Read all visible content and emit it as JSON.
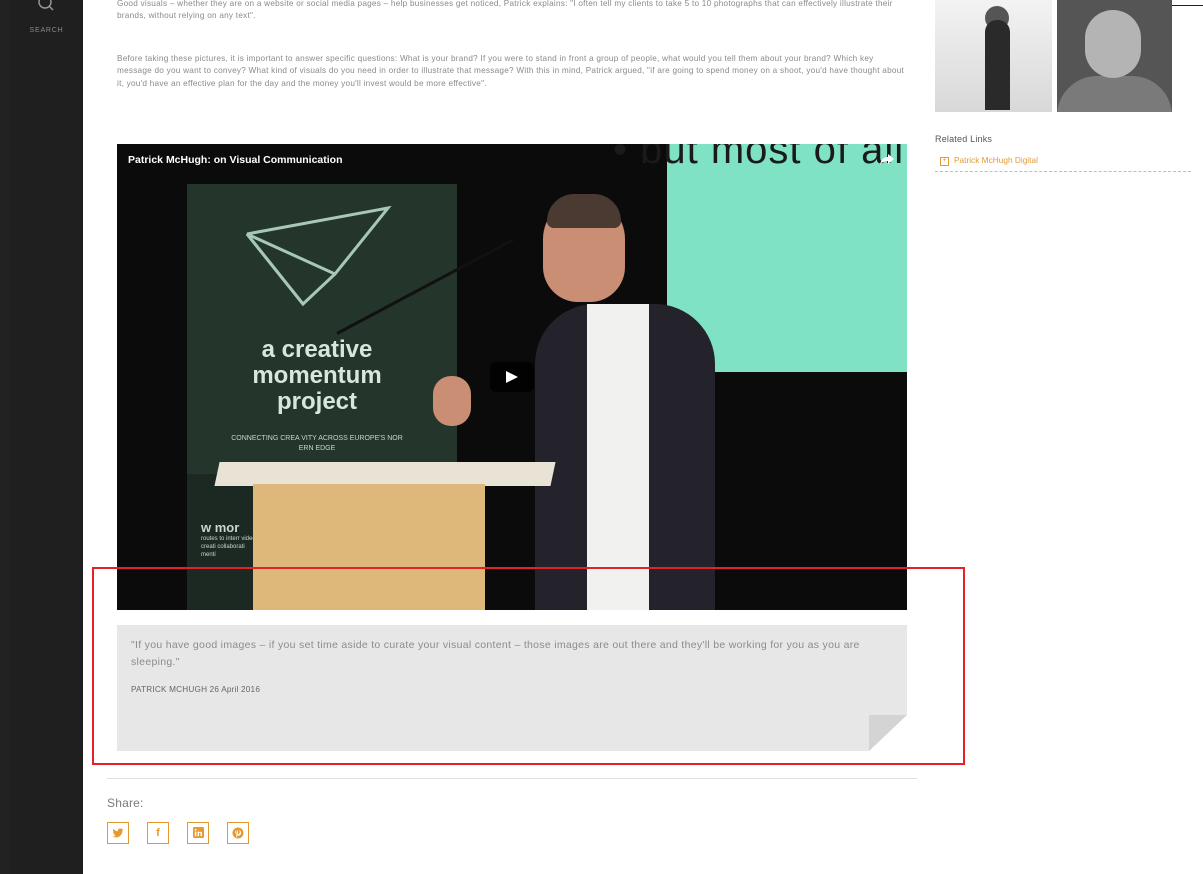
{
  "sidebar": {
    "search_label": "SEARCH"
  },
  "article": {
    "paragraph1": "Good visuals – whether they are on a website or social media pages – help businesses get noticed, Patrick explains: \"I often tell my clients to take 5 to 10 photographs that can effectively illustrate their brands, without relying on any text\".",
    "paragraph2": "Before taking these pictures, it is important to answer specific questions:  What is your brand? If you were to stand in front a group of people, what would you tell them about your brand? Which key message do you want to convey? What kind of visuals do you need in order to illustrate that message? With this in mind, Patrick argued, \"if are going to spend money on a shoot, you'd have thought about it, you'd have an effective plan for the day and the money you'll invest would be more effective\"."
  },
  "video": {
    "title": "Patrick McHugh: on Visual Communication",
    "screen_text": "• but most of all",
    "banner_title": "a creative momentum project",
    "banner_subtitle": "CONNECTING CREA  VITY ACROSS EUROPE'S NOR  ERN EDGE",
    "banner_side_big": "w mor",
    "banner_side_small": "routes to interr video p creati collaborati menti"
  },
  "quote": {
    "text": "\"If you have good images – if you set time aside to curate your visual content – those images are out there and they'll be working for you as you are sleeping.\"",
    "author": "PATRICK MCHUGH",
    "date": "26 April 2016"
  },
  "share": {
    "label": "Share:",
    "buttons": [
      "twitter",
      "facebook",
      "linkedin",
      "pinterest"
    ]
  },
  "related": {
    "title": "Related Links",
    "links": [
      "Patrick McHugh Digital"
    ]
  },
  "colors": {
    "accent": "#e59a31",
    "highlight": "#e32227",
    "sidebar": "#1f1f1f"
  }
}
